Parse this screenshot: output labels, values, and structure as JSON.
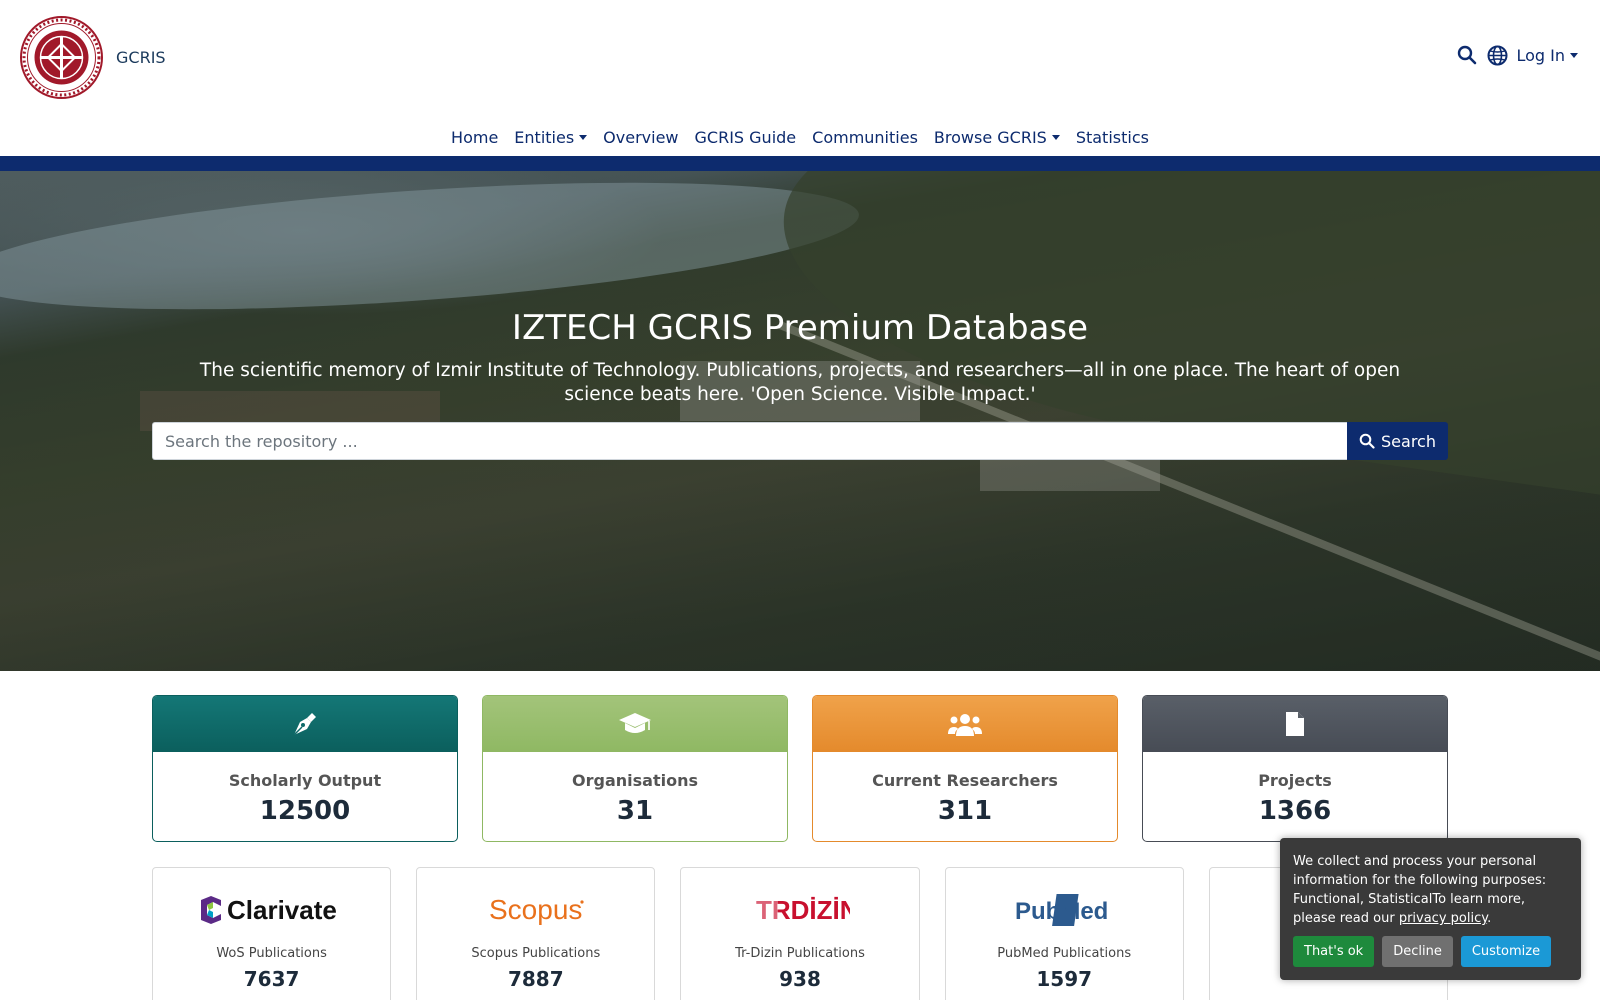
{
  "header": {
    "brand": "GCRIS",
    "logo_icon": "iztech-seal-logo",
    "search_icon": "search-icon",
    "language_icon": "globe-icon",
    "login_label": "Log In"
  },
  "nav": {
    "items": [
      {
        "label": "Home",
        "dropdown": false
      },
      {
        "label": "Entities",
        "dropdown": true
      },
      {
        "label": "Overview",
        "dropdown": false
      },
      {
        "label": "GCRIS Guide",
        "dropdown": false
      },
      {
        "label": "Communities",
        "dropdown": false
      },
      {
        "label": "Browse GCRIS",
        "dropdown": true
      },
      {
        "label": "Statistics",
        "dropdown": false
      }
    ]
  },
  "hero": {
    "title": "IZTECH GCRIS Premium Database",
    "subtitle": "The scientific memory of Izmir Institute of Technology. Publications, projects, and researchers—all in one place. The heart of open science beats here. 'Open Science. Visible Impact.'",
    "search_placeholder": "Search the repository ...",
    "search_button": "Search"
  },
  "stats": [
    {
      "label": "Scholarly Output",
      "value": "12500",
      "icon": "pen-nib-icon",
      "color_top": "#147776",
      "color_bottom": "#0b5f5d"
    },
    {
      "label": "Organisations",
      "value": "31",
      "icon": "graduation-cap-icon",
      "color_top": "#a3c47a",
      "color_bottom": "#8fb863"
    },
    {
      "label": "Current Researchers",
      "value": "311",
      "icon": "users-icon",
      "color_top": "#f0a24a",
      "color_bottom": "#e48a2c"
    },
    {
      "label": "Projects",
      "value": "1366",
      "icon": "file-icon",
      "color_top": "#595f68",
      "color_bottom": "#474c55"
    }
  ],
  "publications": [
    {
      "logo_text": "Clarivate",
      "label": "WoS Publications",
      "value": "7637"
    },
    {
      "logo_text": "Scopus",
      "label": "Scopus Publications",
      "value": "7887"
    },
    {
      "logo_text": "TRDİZİN",
      "label": "Tr-Dizin Publications",
      "value": "938"
    },
    {
      "logo_text": "PubMed",
      "label": "PubMed Publications",
      "value": "1597"
    }
  ],
  "cookie": {
    "text": "We collect and process your personal information for the following purposes: Functional, StatisticalTo learn more, please read our ",
    "link": "privacy policy",
    "suffix": ".",
    "accept": "That's ok",
    "decline": "Decline",
    "customize": "Customize",
    "colors": {
      "accept": "#1e8a3c",
      "decline": "#707070",
      "customize": "#1b99d6"
    }
  }
}
